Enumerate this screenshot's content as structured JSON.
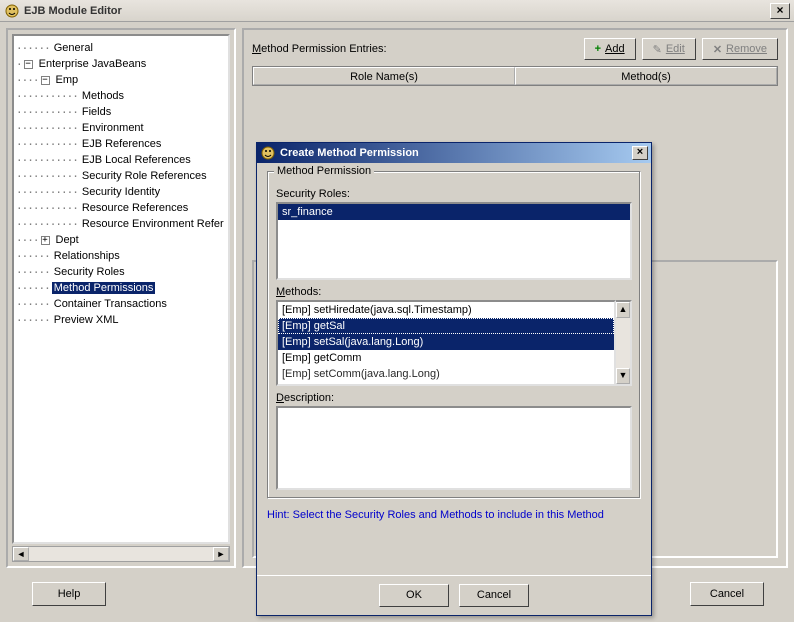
{
  "window": {
    "title": "EJB Module Editor",
    "close_glyph": "×"
  },
  "tree": {
    "general": "General",
    "ejb": "Enterprise JavaBeans",
    "emp": "Emp",
    "emp_children": {
      "methods": "Methods",
      "fields": "Fields",
      "environment": "Environment",
      "ejb_refs": "EJB References",
      "ejb_local_refs": "EJB Local References",
      "sec_role_refs": "Security Role References",
      "sec_identity": "Security Identity",
      "res_refs": "Resource References",
      "res_env_refs": "Resource Environment Refer"
    },
    "dept": "Dept",
    "relationships": "Relationships",
    "security_roles": "Security Roles",
    "method_permissions": "Method Permissions",
    "container_tx": "Container Transactions",
    "preview_xml": "Preview XML"
  },
  "right": {
    "entries_label": "Method Permission Entries:",
    "add": "Add",
    "edit": "Edit",
    "remove": "Remove",
    "col_role": "Role Name(s)",
    "col_method": "Method(s)"
  },
  "main_buttons": {
    "help": "Help",
    "cancel": "Cancel"
  },
  "dialog": {
    "title": "Create Method Permission",
    "close_glyph": "×",
    "group_label": "Method Permission",
    "roles_label": "Security Roles:",
    "roles": [
      "sr_finance"
    ],
    "methods_label": "Methods:",
    "methods": [
      "[Emp] setHiredate(java.sql.Timestamp)",
      "[Emp] getSal",
      "[Emp] setSal(java.lang.Long)",
      "[Emp] getComm",
      "[Emp] setComm(java.lang.Long)"
    ],
    "desc_label": "Description:",
    "hint": "Hint:   Select the Security Roles and Methods to include in this Method",
    "ok": "OK",
    "cancel": "Cancel"
  }
}
